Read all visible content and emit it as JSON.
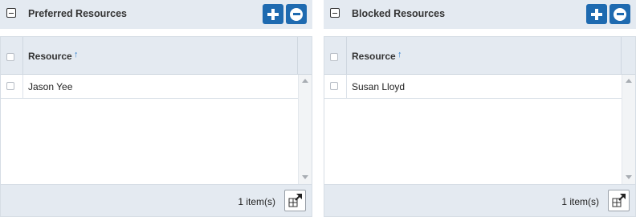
{
  "panels": [
    {
      "title": "Preferred Resources",
      "column_header": "Resource",
      "sort_indicator": "↑",
      "rows": [
        {
          "name": "Jason Yee"
        }
      ],
      "item_count": "1 item(s)"
    },
    {
      "title": "Blocked Resources",
      "column_header": "Resource",
      "sort_indicator": "↑",
      "rows": [
        {
          "name": "Susan Lloyd"
        }
      ],
      "item_count": "1 item(s)"
    }
  ],
  "icons": {
    "collapse": "collapse-icon",
    "add": "plus-icon",
    "remove": "minus-circle-icon",
    "popout": "popout-icon"
  },
  "colors": {
    "accent": "#1e6ab0",
    "header_bg": "#e4eaf1",
    "sort_arrow": "#2f7fcf"
  }
}
